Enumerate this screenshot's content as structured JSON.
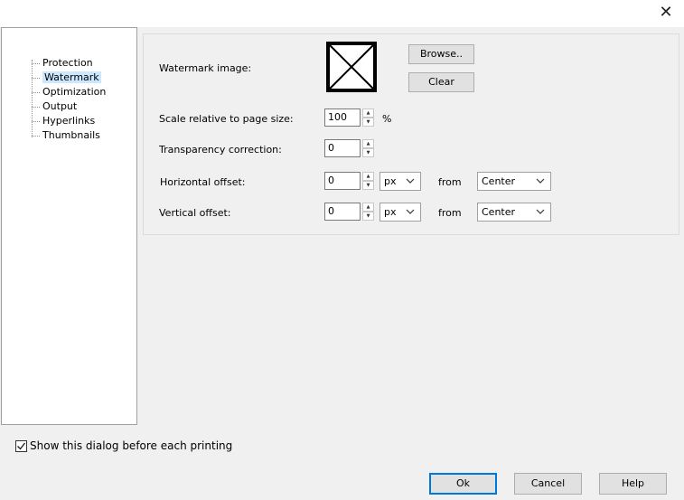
{
  "window": {
    "close_glyph": "✕"
  },
  "tree": {
    "items": [
      {
        "label": "Protection",
        "selected": false
      },
      {
        "label": "Watermark",
        "selected": true
      },
      {
        "label": "Optimization",
        "selected": false
      },
      {
        "label": "Output",
        "selected": false
      },
      {
        "label": "Hyperlinks",
        "selected": false
      },
      {
        "label": "Thumbnails",
        "selected": false
      }
    ]
  },
  "watermark": {
    "image_label": "Watermark image:",
    "browse_label": "Browse..",
    "clear_label": "Clear",
    "scale_label": "Scale relative to page size:",
    "scale_value": "100",
    "scale_unit": "%",
    "transparency_label": "Transparency correction:",
    "transparency_value": "0",
    "horizontal_label": "Horizontal offset:",
    "horizontal_value": "0",
    "horizontal_unit": "px",
    "horizontal_from_label": "from",
    "horizontal_from": "Center",
    "vertical_label": "Vertical offset:",
    "vertical_value": "0",
    "vertical_unit": "px",
    "vertical_from_label": "from",
    "vertical_from": "Center"
  },
  "footer": {
    "show_dialog_label": "Show this dialog before each printing",
    "show_dialog_checked": true,
    "ok_label": "Ok",
    "cancel_label": "Cancel",
    "help_label": "Help"
  },
  "colors": {
    "selection": "#cce8ff",
    "default_button_border": "#0078d7"
  },
  "icons": {
    "close": "close-icon",
    "spin_up": "spin-up-icon",
    "spin_down": "spin-down-icon",
    "dropdown": "chevron-down-icon",
    "checkmark": "checkmark-icon"
  }
}
